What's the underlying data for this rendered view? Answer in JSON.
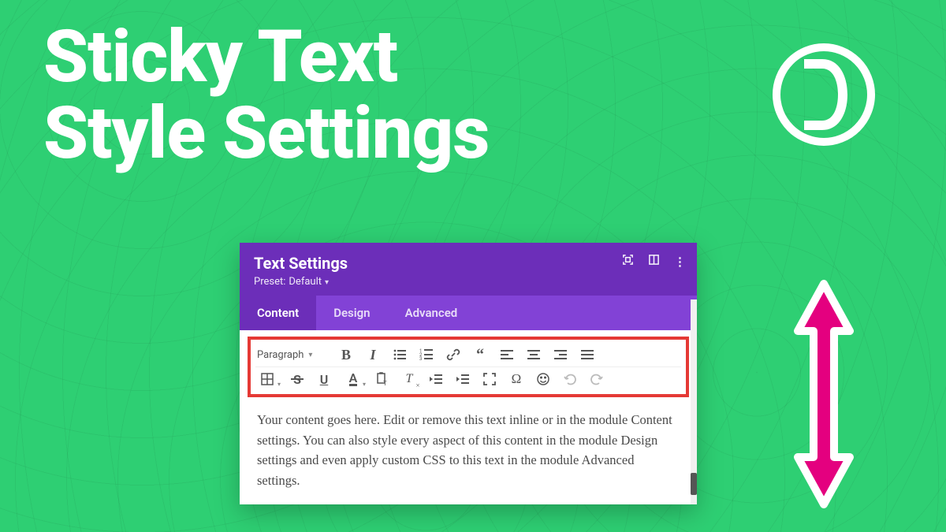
{
  "hero": {
    "title_line1": "Sticky Text",
    "title_line2": "Style Settings"
  },
  "logo": {
    "letter": "D"
  },
  "colors": {
    "background": "#2ecf73",
    "panel_header": "#6c2eb9",
    "tabs_bar": "#8242d6",
    "highlight_border": "#e53935",
    "arrow": "#e4007f"
  },
  "panel": {
    "title": "Text Settings",
    "preset_label": "Preset:",
    "preset_value": "Default",
    "tabs": [
      {
        "label": "Content",
        "active": true
      },
      {
        "label": "Design",
        "active": false
      },
      {
        "label": "Advanced",
        "active": false
      }
    ],
    "header_icons": [
      "expand",
      "panel-layout",
      "more"
    ]
  },
  "toolbar": {
    "format_label": "Paragraph",
    "row1": [
      "bold",
      "italic",
      "bulleted-list",
      "numbered-list",
      "link",
      "blockquote",
      "align-left",
      "align-center",
      "align-right",
      "align-justify"
    ],
    "row2": [
      "table",
      "strikethrough",
      "underline",
      "text-color",
      "paste-text",
      "clear-format",
      "outdent",
      "indent",
      "fullscreen",
      "special-char",
      "emoji",
      "undo",
      "redo"
    ]
  },
  "content": {
    "body": "Your content goes here. Edit or remove this text inline or in the module Content settings. You can also style every aspect of this content in the module Design settings and even apply custom CSS to this text in the module Advanced settings."
  }
}
